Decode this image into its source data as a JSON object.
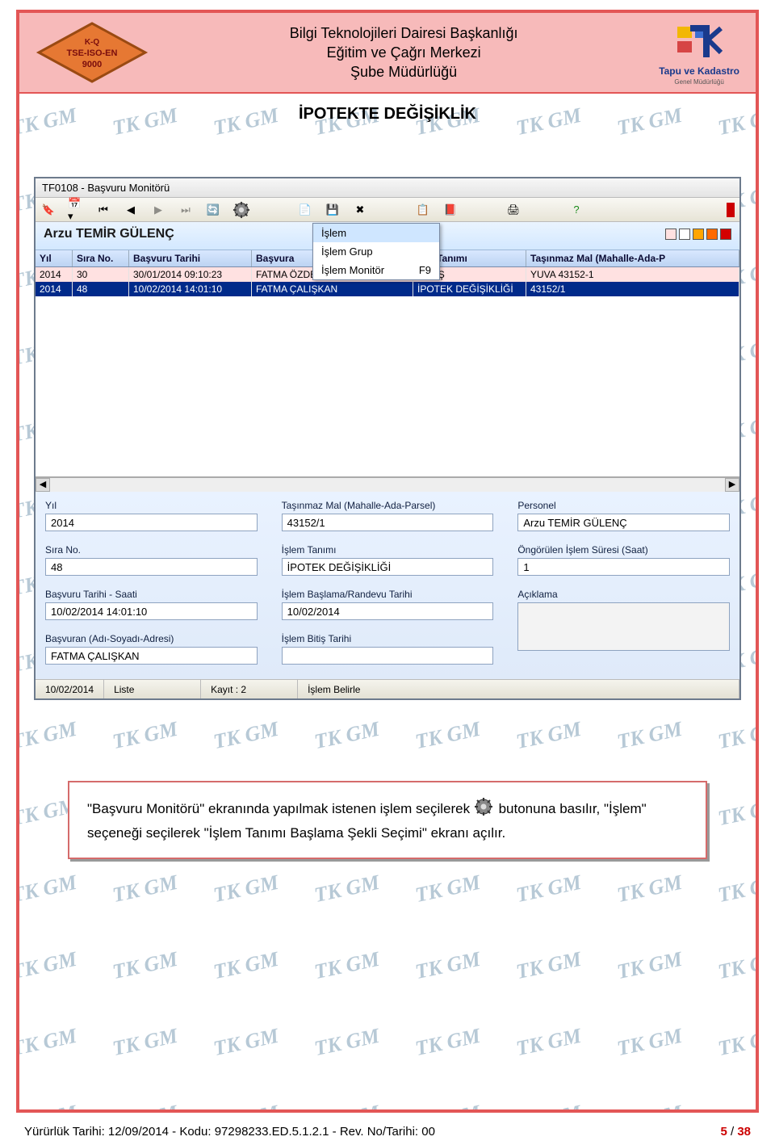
{
  "header": {
    "line1": "Bilgi Teknolojileri Dairesi Başkanlığı",
    "line2": "Eğitim ve Çağrı Merkezi",
    "line3": "Şube Müdürlüğü",
    "left_logo_text": "K-Q TSE-ISO-EN 9000",
    "right_logo_text": "Tapu ve Kadastro",
    "right_logo_sub": "Genel Müdürlüğü"
  },
  "doc_title": "İPOTEKTE DEĞİŞİKLİK",
  "window": {
    "title": "TF0108 - Başvuru Monitörü",
    "user": "Arzu TEMİR GÜLENÇ",
    "dropdown": {
      "item1": "İşlem",
      "item2": "İşlem Grup",
      "item3_label": "İşlem Monitör",
      "item3_key": "F9"
    },
    "columns": {
      "c0": "Yıl",
      "c1": "Sıra No.",
      "c2": "Başvuru Tarihi",
      "c3": "Başvura",
      "c4": "lem Tanımı",
      "c5": "Taşınmaz Mal (Mahalle-Ada-P"
    },
    "rows": [
      {
        "yil": "2014",
        "sira": "30",
        "tarih": "30/01/2014 09:10:23",
        "basvuran": "FATMA ÖZDEMİR",
        "islem": "SATIŞ",
        "tasinmaz": "YUVA 43152-1"
      },
      {
        "yil": "2014",
        "sira": "48",
        "tarih": "10/02/2014 14:01:10",
        "basvuran": "FATMA ÇALIŞKAN",
        "islem": "İPOTEK DEĞİŞİKLİĞİ",
        "tasinmaz": "43152/1"
      }
    ],
    "form": {
      "yil_label": "Yıl",
      "yil_value": "2014",
      "tasinmaz_label": "Taşınmaz Mal (Mahalle-Ada-Parsel)",
      "tasinmaz_value": "43152/1",
      "personel_label": "Personel",
      "personel_value": "Arzu TEMİR GÜLENÇ",
      "sira_label": "Sıra No.",
      "sira_value": "48",
      "islemtanimi_label": "İşlem Tanımı",
      "islemtanimi_value": "İPOTEK DEĞİŞİKLİĞİ",
      "sure_label": "Öngörülen İşlem Süresi (Saat)",
      "sure_value": "1",
      "basvurutarih_label": "Başvuru Tarihi - Saati",
      "basvurutarih_value": "10/02/2014 14:01:10",
      "randevu_label": "İşlem Başlama/Randevu Tarihi",
      "randevu_value": "10/02/2014",
      "aciklama_label": "Açıklama",
      "basvuran_label": "Başvuran (Adı-Soyadı-Adresi)",
      "basvuran_value": "FATMA ÇALIŞKAN",
      "bitis_label": "İşlem Bitiş Tarihi"
    },
    "status": {
      "s0": "10/02/2014",
      "s1": "Liste",
      "s2": "Kayıt : 2",
      "s3": "İşlem Belirle"
    }
  },
  "note": {
    "text_a": "\"Başvuru Monitörü\" ekranında yapılmak istenen işlem seçilerek ",
    "text_b": " butonuna basılır, \"İşlem\" seçeneği seçilerek \"İşlem Tanımı Başlama Şekli Seçimi\" ekranı açılır."
  },
  "footer": {
    "left": "Yürürlük Tarihi: 12/09/2014 - Kodu: 97298233.ED.5.1.2.1 - Rev. No/Tarihi: 00",
    "page_cur": "5",
    "page_sep": " / ",
    "page_total": "38"
  },
  "colors": {
    "sw1": "#ffe1e1",
    "sw2": "#ffffff",
    "sw3": "#ffa500",
    "sw4": "#ff6a00",
    "sw5": "#d40000"
  }
}
